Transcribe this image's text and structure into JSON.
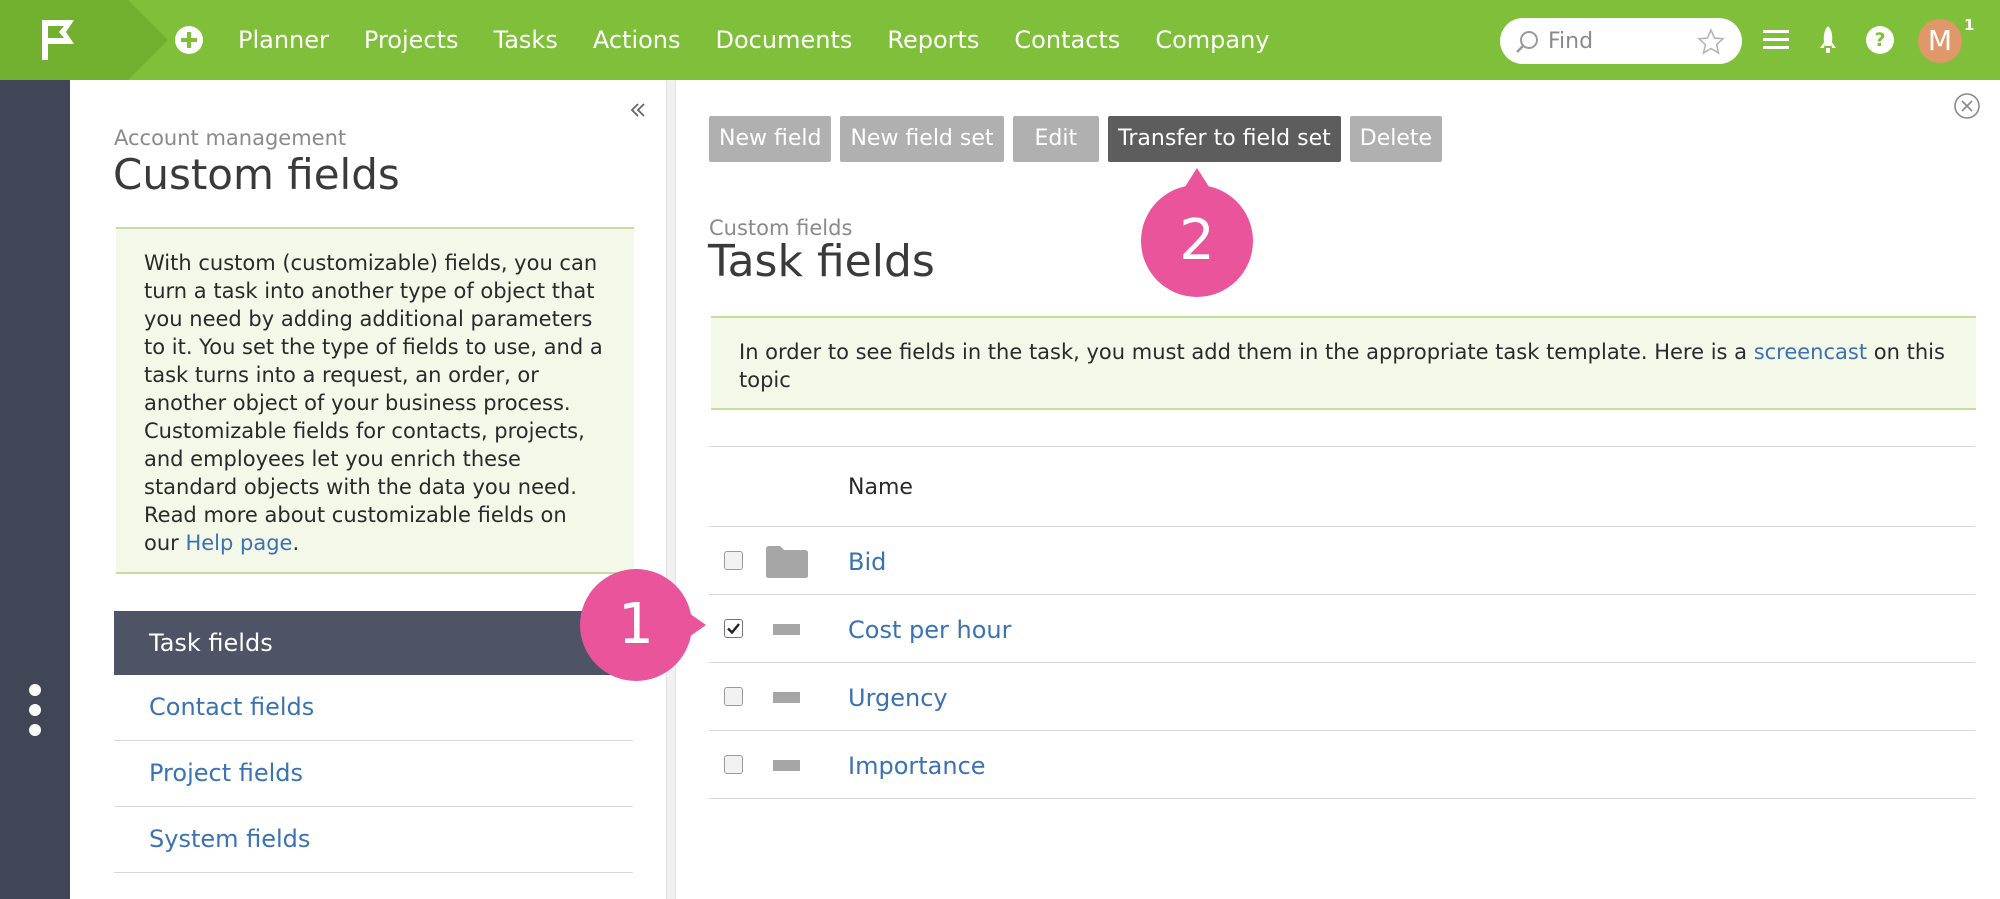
{
  "topbar": {
    "nav": [
      "Planner",
      "Projects",
      "Tasks",
      "Actions",
      "Documents",
      "Reports",
      "Contacts",
      "Company"
    ],
    "search_placeholder": "Find",
    "avatar_initial": "M",
    "notification_count": "1",
    "accent_color": "#80bf3a"
  },
  "sidebar": {
    "supertitle": "Account management",
    "title": "Custom fields",
    "info_text": "With custom (customizable) fields, you can turn a task into another type of object that you need by adding additional parameters to it. You set the type of fields to use, and a task turns into a request, an order, or another object of your business process. Customizable fields for contacts, projects, and employees let you enrich these standard objects with the data you need. Read more about customizable fields on our ",
    "info_link": "Help page",
    "info_end": ".",
    "menu": [
      "Task fields",
      "Contact fields",
      "Project fields",
      "System fields"
    ]
  },
  "toolbar": {
    "new_field": "New field",
    "new_field_set": "New field set",
    "edit": "Edit",
    "transfer": "Transfer to field set",
    "delete": "Delete"
  },
  "main": {
    "supertitle": "Custom fields",
    "title": "Task fields",
    "notice_text": "In order to see fields in the task, you must add them in the appropriate task template. Here is a ",
    "notice_link": "screencast",
    "notice_end": " on this topic",
    "table_header": "Name",
    "rows": [
      {
        "name": "Bid",
        "type": "folder",
        "checked": false
      },
      {
        "name": "Cost per hour",
        "type": "field",
        "checked": true
      },
      {
        "name": "Urgency",
        "type": "field",
        "checked": false
      },
      {
        "name": "Importance",
        "type": "field",
        "checked": false
      }
    ]
  },
  "callouts": [
    "1",
    "2"
  ]
}
